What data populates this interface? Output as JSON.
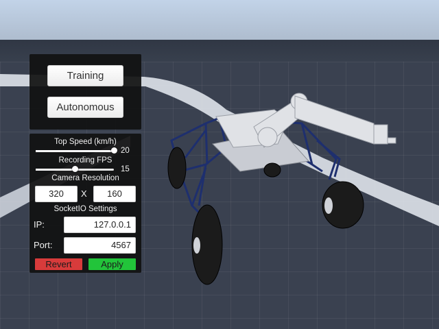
{
  "mode_panel": {
    "training_label": "Training",
    "autonomous_label": "Autonomous"
  },
  "settings": {
    "top_speed": {
      "label": "Top Speed (km/h)",
      "value": "20",
      "level": 1.0
    },
    "recording_fps": {
      "label": "Recording FPS",
      "value": "15",
      "level": 0.5
    },
    "camera_resolution": {
      "label": "Camera Resolution",
      "width": "320",
      "separator": "X",
      "height": "160"
    },
    "socketio": {
      "label": "SocketIO Settings",
      "ip_label": "IP:",
      "ip_value": "127.0.0.1",
      "port_label": "Port:",
      "port_value": "4567"
    },
    "revert_label": "Revert",
    "apply_label": "Apply"
  },
  "colors": {
    "panel_bg": "#111111",
    "revert": "#d83b3b",
    "apply": "#22c43a",
    "rover_frame": "#1e2f6e",
    "rover_arm": "#e0e2e6",
    "ground": "#3a4150",
    "sky": "#b8c7da"
  }
}
